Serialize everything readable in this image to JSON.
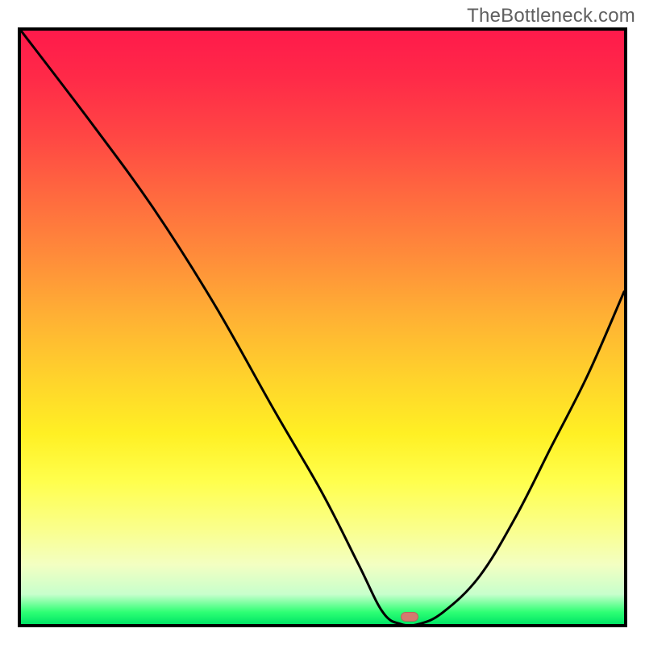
{
  "watermark": "TheBottleneck.com",
  "chart_data": {
    "type": "line",
    "title": "",
    "xlabel": "",
    "ylabel": "",
    "xlim": [
      0,
      100
    ],
    "ylim": [
      0,
      100
    ],
    "legend": false,
    "grid": false,
    "series": [
      {
        "name": "bottleneck-curve",
        "x": [
          0,
          12,
          22,
          32,
          42,
          50,
          56,
          60,
          63,
          66,
          70,
          76,
          82,
          88,
          94,
          100
        ],
        "values": [
          100,
          84,
          70,
          54,
          36,
          22,
          10,
          2,
          0,
          0,
          2,
          8,
          18,
          30,
          42,
          56
        ]
      }
    ],
    "annotations": [
      {
        "name": "optimal-marker",
        "x": 64.5,
        "y": 1,
        "shape": "rounded-rect",
        "color": "#d5796f"
      }
    ],
    "background_gradient": {
      "direction": "vertical",
      "stops": [
        {
          "pos": 0.0,
          "color": "#ff1a4b"
        },
        {
          "pos": 0.4,
          "color": "#ff8c3a"
        },
        {
          "pos": 0.68,
          "color": "#fff024"
        },
        {
          "pos": 0.9,
          "color": "#f3ffc2"
        },
        {
          "pos": 1.0,
          "color": "#00e566"
        }
      ]
    }
  }
}
